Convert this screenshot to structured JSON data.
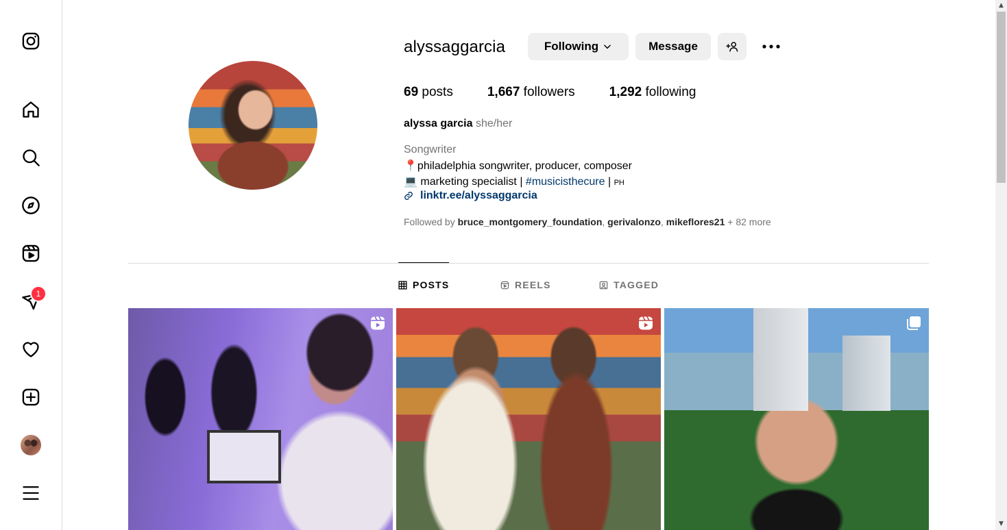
{
  "profile": {
    "username": "alyssaggarcia",
    "following_button": "Following",
    "message_button": "Message",
    "stats": {
      "posts_count": "69",
      "posts_label": "posts",
      "followers_count": "1,667",
      "followers_label": "followers",
      "following_count": "1,292",
      "following_label": "following"
    },
    "full_name": "alyssa garcia",
    "pronouns": "she/her",
    "category": "Songwriter",
    "bio_line1": "📍philadelphia songwriter, producer, composer",
    "bio_line2_prefix": "💻 marketing specialist | ",
    "bio_hashtag": "#musicisthecure",
    "bio_line2_suffix": " | ",
    "bio_flag": "PH",
    "link": "linktr.ee/alyssaggarcia",
    "followed_by_prefix": "Followed by ",
    "followed_by_users": [
      "bruce_montgomery_foundation",
      "gerivalonzo",
      "mikeflores21"
    ],
    "followed_by_more": " + 82 more"
  },
  "tabs": [
    {
      "label": "POSTS",
      "active": true
    },
    {
      "label": "REELS",
      "active": false
    },
    {
      "label": "TAGGED",
      "active": false
    }
  ],
  "sidebar": {
    "notification_count": "1",
    "icons": [
      "instagram-icon",
      "home-icon",
      "search-icon",
      "explore-icon",
      "reels-icon",
      "messages-icon",
      "notifications-icon",
      "create-icon",
      "profile-avatar",
      "menu-icon"
    ]
  },
  "posts": [
    {
      "type": "reel"
    },
    {
      "type": "reel"
    },
    {
      "type": "carousel"
    }
  ],
  "colors": {
    "link": "#00376b",
    "muted": "#737373",
    "button_bg": "#efefef",
    "badge": "#ff3040",
    "border": "#dbdbdb"
  }
}
